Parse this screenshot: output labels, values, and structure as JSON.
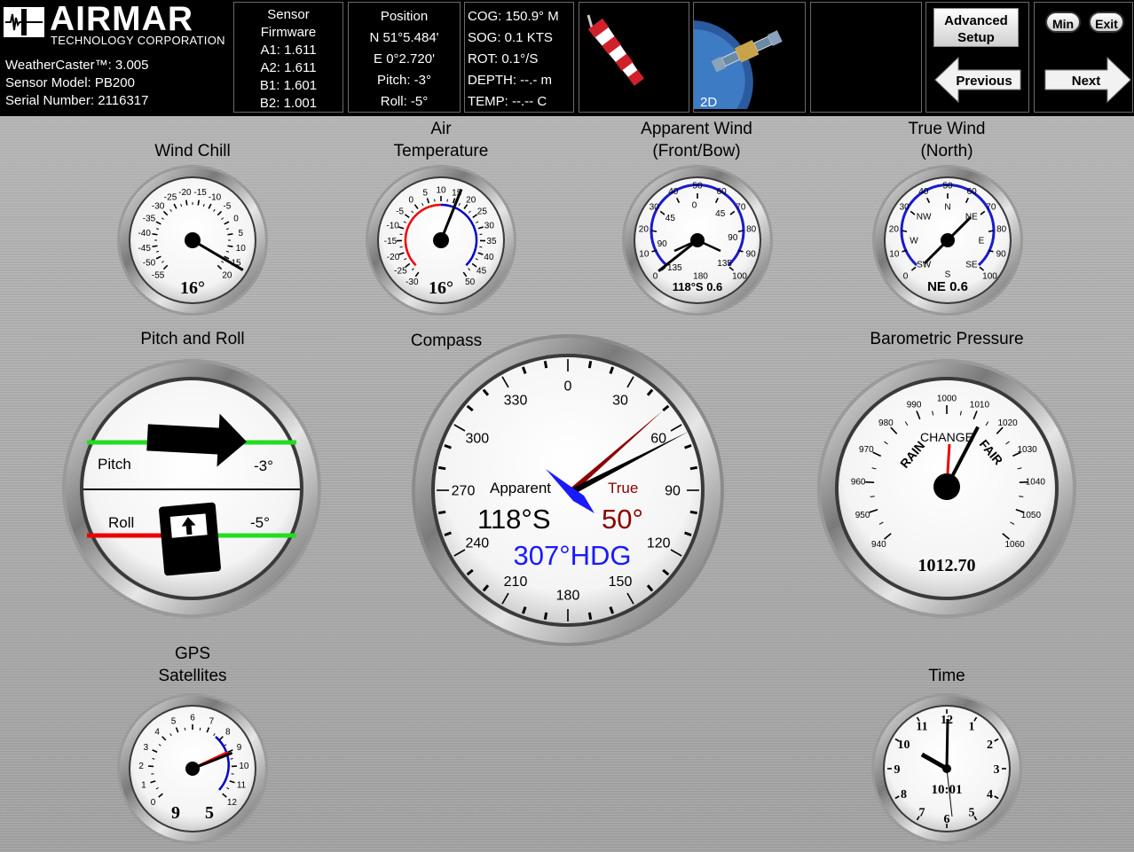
{
  "brand": {
    "logo_text": "AIRMAR",
    "logo_sub": "TECHNOLOGY CORPORATION",
    "app_version": "WeatherCaster™: 3.005",
    "sensor_model": "Sensor Model: PB200",
    "serial_number": "Serial Number: 2116317"
  },
  "firmware": {
    "title_line1": "Sensor",
    "title_line2": "Firmware",
    "a1": "A1: 1.611",
    "a2": "A2: 1.611",
    "b1": "B1: 1.601",
    "b2": "B2: 1.001"
  },
  "position": {
    "title": "Position",
    "lat": "N 51°5.484'",
    "lon": "E 0°2.720'",
    "pitch": "Pitch: -3°",
    "roll": "Roll: -5°"
  },
  "nav": {
    "cog": "COG: 150.9° M",
    "sog": "SOG: 0.1 KTS",
    "rot": "ROT: 0.1°/S",
    "depth": "DEPTH: --.- m",
    "temp": "TEMP: --.-- C"
  },
  "gps_fix": "2D",
  "buttons": {
    "advanced_setup_l1": "Advanced",
    "advanced_setup_l2": "Setup",
    "previous": "Previous",
    "next": "Next",
    "min": "Min",
    "exit": "Exit"
  },
  "gauges": {
    "wind_chill": {
      "title": "Wind Chill",
      "value": "16°",
      "ticks": [
        "-55",
        "-50",
        "-45",
        "-40",
        "-35",
        "-30",
        "-25",
        "-20",
        "-15",
        "-10",
        "-5",
        "0",
        "5",
        "10",
        "15",
        "20"
      ],
      "needle_value": 16
    },
    "air_temp": {
      "title_l1": "Air",
      "title_l2": "Temperature",
      "value": "16°",
      "ticks": [
        "-30",
        "-25",
        "-20",
        "-15",
        "-10",
        "-5",
        "0",
        "5",
        "10",
        "15",
        "20",
        "25",
        "30",
        "35",
        "40",
        "45",
        "50"
      ],
      "needle_value": 16
    },
    "apparent_wind": {
      "title_l1": "Apparent Wind",
      "title_l2": "(Front/Bow)",
      "value": "118°S  0.6",
      "outer_ticks": [
        "0",
        "10",
        "20",
        "30",
        "40",
        "50",
        "60",
        "70",
        "80",
        "90",
        "100"
      ],
      "inner_ticks": [
        "135",
        "90",
        "45",
        "0",
        "45",
        "90",
        "135",
        "180"
      ],
      "needle_value": 0.6
    },
    "true_wind": {
      "title_l1": "True Wind",
      "title_l2": "(North)",
      "value": "NE 0.6",
      "outer_ticks": [
        "0",
        "10",
        "20",
        "30",
        "40",
        "50",
        "60",
        "70",
        "80",
        "90",
        "100"
      ],
      "inner_ticks": [
        "SW",
        "W",
        "NW",
        "N",
        "NE",
        "E",
        "SE",
        "S"
      ],
      "needle_value": 0.6
    },
    "pitch_roll": {
      "title": "Pitch and Roll",
      "pitch_label": "Pitch",
      "pitch_value": "-3°",
      "roll_label": "Roll",
      "roll_value": "-5°"
    },
    "compass": {
      "title": "Compass",
      "ticks": [
        "0",
        "30",
        "60",
        "90",
        "120",
        "150",
        "180",
        "210",
        "240",
        "270",
        "300",
        "330"
      ],
      "apparent_label": "Apparent",
      "apparent_value": "118°S",
      "true_label": "True",
      "true_value": "50°",
      "heading": "307°HDG",
      "apparent_colour": "#1a1aff",
      "true_colour": "#8b0000",
      "heading_deg": 307,
      "true_deg": 50,
      "cog_deg": 60
    },
    "barometer": {
      "title": "Barometric Pressure",
      "ticks": [
        "940",
        "950",
        "960",
        "970",
        "980",
        "990",
        "1000",
        "1010",
        "1020",
        "1030",
        "1040",
        "1050",
        "1060"
      ],
      "change_label": "CHANGE",
      "rain_label": "RAIN",
      "fair_label": "FAIR",
      "value": "1012.70",
      "needle_value": 1012.7
    },
    "gps_sats": {
      "title_l1": "GPS",
      "title_l2": "Satellites",
      "ticks": [
        "0",
        "1",
        "2",
        "3",
        "4",
        "5",
        "6",
        "7",
        "8",
        "9",
        "10",
        "11",
        "12"
      ],
      "visible": "9",
      "used": "5",
      "visible_value": 9,
      "used_value": 5
    },
    "time": {
      "title": "Time",
      "ticks": [
        "12",
        "1",
        "2",
        "3",
        "4",
        "5",
        "6",
        "7",
        "8",
        "9",
        "10",
        "11"
      ],
      "value": "10:01"
    }
  }
}
